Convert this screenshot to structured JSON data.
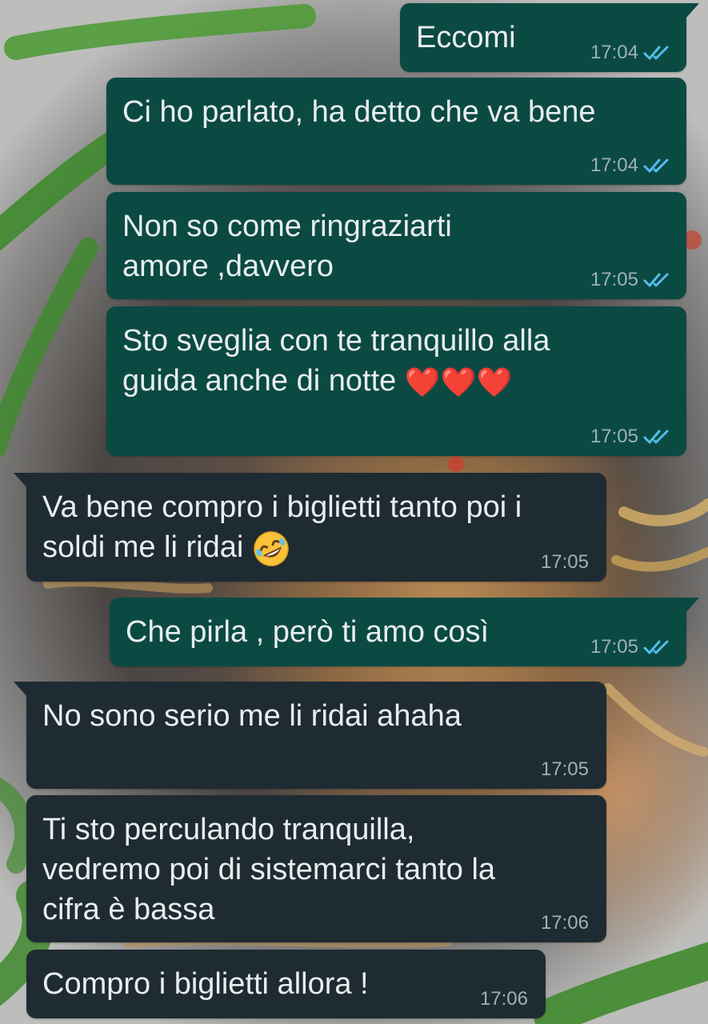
{
  "messages": [
    {
      "id": 1,
      "direction": "outgoing",
      "text": "Eccomi",
      "time": "17:04",
      "status": "read"
    },
    {
      "id": 2,
      "direction": "outgoing",
      "text": "Ci ho parlato, ha detto che va bene",
      "time": "17:04",
      "status": "read"
    },
    {
      "id": 3,
      "direction": "outgoing",
      "text": "Non so come ringraziarti\namore ,davvero",
      "time": "17:05",
      "status": "read"
    },
    {
      "id": 4,
      "direction": "outgoing",
      "text": "Sto sveglia con te tranquillo alla\nguida anche di notte ",
      "emoji": "❤️❤️❤️",
      "time": "17:05",
      "status": "read"
    },
    {
      "id": 5,
      "direction": "incoming",
      "text": "Va bene compro i biglietti tanto poi i\nsoldi me li ridai ",
      "emoji": "🤣",
      "time": "17:05"
    },
    {
      "id": 6,
      "direction": "outgoing",
      "text": "Che pirla , però ti amo così",
      "time": "17:05",
      "status": "read"
    },
    {
      "id": 7,
      "direction": "incoming",
      "text": "No sono serio me li ridai ahaha",
      "time": "17:05"
    },
    {
      "id": 8,
      "direction": "incoming",
      "text": "Ti sto perculando tranquilla,\nvedremo poi di sistemarci tanto la\ncifra è bassa",
      "time": "17:06"
    },
    {
      "id": 9,
      "direction": "incoming",
      "text": "Compro i biglietti allora !",
      "time": "17:06"
    }
  ],
  "colors": {
    "outgoing_bubble": "#0b4a43",
    "incoming_bubble": "#1f2b32",
    "read_ticks": "#53bdeb",
    "timestamp": "#9fb0b8",
    "message_text": "#e9edef"
  },
  "icons": {
    "read_status": "double-check-icon",
    "heart": "red-heart-icon",
    "laugh": "rolling-on-floor-laughing-icon"
  }
}
